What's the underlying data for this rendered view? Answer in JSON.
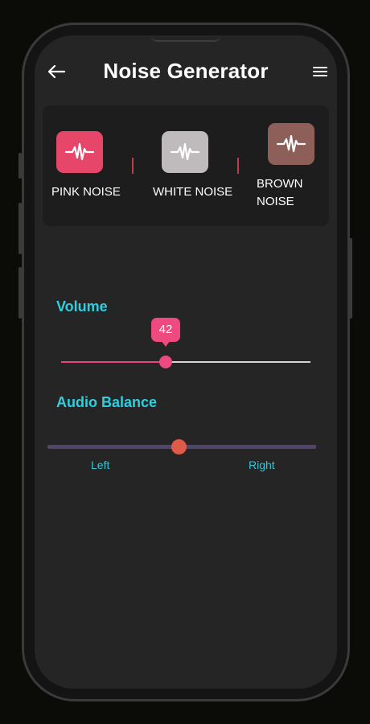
{
  "header": {
    "title": "Noise Generator",
    "back_icon": "arrow-left-icon",
    "menu_icon": "hamburger-menu-icon"
  },
  "noise_types": [
    {
      "label": "PINK NOISE",
      "icon": "waveform-icon",
      "color": "#e7466b"
    },
    {
      "label": "WHITE NOISE",
      "icon": "waveform-icon",
      "color": "#bfbabb"
    },
    {
      "label": "BROWN NOISE",
      "icon": "waveform-icon",
      "color": "#8e5e59"
    }
  ],
  "volume": {
    "label": "Volume",
    "value": "42",
    "fraction": 0.42,
    "active_color": "#ee4a80",
    "inactive_color": "#d4d4d4"
  },
  "balance": {
    "label": "Audio Balance",
    "left_label": "Left",
    "right_label": "Right",
    "fraction": 0.5,
    "track_color": "#54436c",
    "thumb_color": "#e05a48"
  },
  "accent_color": "#2ed0e0"
}
